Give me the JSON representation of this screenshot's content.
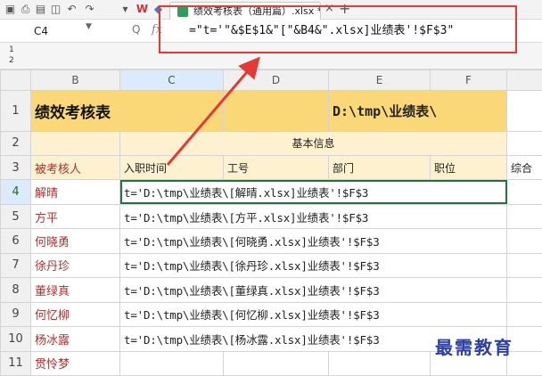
{
  "toolbar": {
    "icons": [
      "save-icon",
      "print-icon",
      "print-preview-icon",
      "export-icon",
      "undo-icon",
      "redo-icon",
      "dropdown-icon",
      "wps-logo-icon",
      "box-icon"
    ],
    "logo_text": "W",
    "tab_title": "绩效考核表（通用篇）.xlsx *",
    "tab_close": "×",
    "tab_add": "+"
  },
  "formula_bar": {
    "name_box": "C4",
    "zoom_glyph": "Q",
    "fx_label": "fx",
    "formula": "=\"t='\"&$E$1&\"[\"&B4&\".xlsx]业绩表'!$F$3\""
  },
  "outline": {
    "levels": [
      "1",
      "2"
    ]
  },
  "columns": [
    "B",
    "C",
    "D",
    "E",
    "F"
  ],
  "rows": [
    "1",
    "2",
    "3",
    "4",
    "5",
    "6",
    "7",
    "8",
    "9",
    "10",
    "11"
  ],
  "sheet": {
    "title": "绩效考核表",
    "path_title": "D:\\tmp\\业绩表\\",
    "band_label": "基本信息",
    "headers": {
      "assessee": "被考核人",
      "hire_date": "入职时间",
      "employee_id": "工号",
      "department": "部门",
      "position": "职位",
      "overall": "综合"
    },
    "people": [
      {
        "name": "解晴",
        "result": "t='D:\\tmp\\业绩表\\[解晴.xlsx]业绩表'!$F$3"
      },
      {
        "name": "方平",
        "result": "t='D:\\tmp\\业绩表\\[方平.xlsx]业绩表'!$F$3"
      },
      {
        "name": "何晓勇",
        "result": "t='D:\\tmp\\业绩表\\[何晓勇.xlsx]业绩表'!$F$3"
      },
      {
        "name": "徐丹珍",
        "result": "t='D:\\tmp\\业绩表\\[徐丹珍.xlsx]业绩表'!$F$3"
      },
      {
        "name": "董绿真",
        "result": "t='D:\\tmp\\业绩表\\[董绿真.xlsx]业绩表'!$F$3"
      },
      {
        "name": "何忆柳",
        "result": "t='D:\\tmp\\业绩表\\[何忆柳.xlsx]业绩表'!$F$3"
      },
      {
        "name": "杨冰露",
        "result": "t='D:\\tmp\\业绩表\\[杨冰露.xlsx]业绩表'!$F$3"
      },
      {
        "name": "贯怜梦",
        "result": ""
      }
    ]
  },
  "active_cell": "C4",
  "colors": {
    "title_fill": "#fad878",
    "band_fill": "#fdf1cf",
    "name_text": "#b02f2f",
    "callout": "#e53935",
    "selection": "#217346"
  },
  "watermark": "最需教育"
}
